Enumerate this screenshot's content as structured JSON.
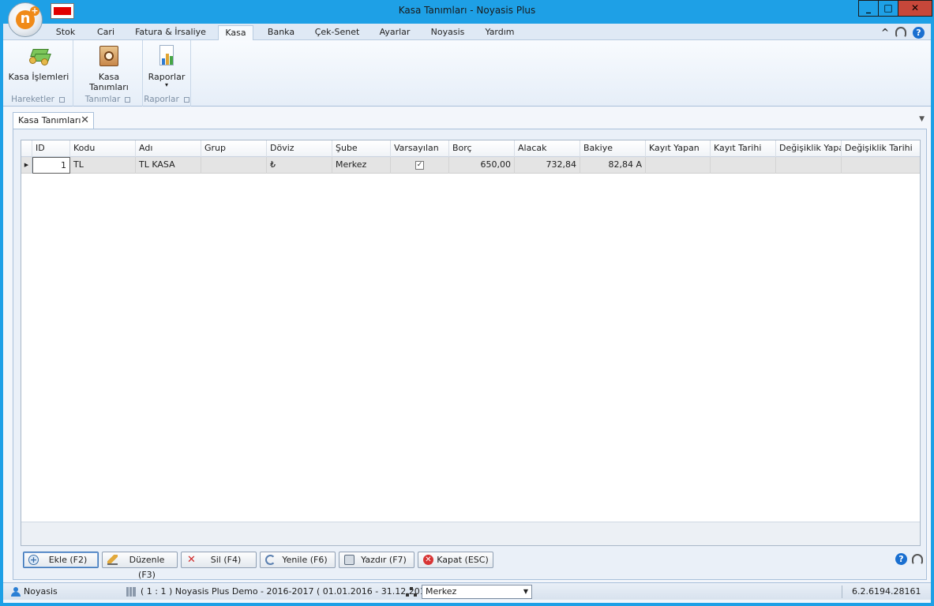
{
  "window": {
    "title": "Kasa Tanımları - Noyasis Plus"
  },
  "menu_tabs": [
    {
      "label": "Stok",
      "active": false
    },
    {
      "label": "Cari",
      "active": false
    },
    {
      "label": "Fatura & İrsaliye",
      "active": false
    },
    {
      "label": "Kasa",
      "active": true
    },
    {
      "label": "Banka",
      "active": false
    },
    {
      "label": "Çek-Senet",
      "active": false
    },
    {
      "label": "Ayarlar",
      "active": false
    },
    {
      "label": "Noyasis",
      "active": false
    },
    {
      "label": "Yardım",
      "active": false
    }
  ],
  "ribbon": {
    "buttons": [
      {
        "label": "Kasa İşlemleri",
        "icon": "money-icon"
      },
      {
        "label": "Kasa Tanımları",
        "icon": "safe-icon"
      },
      {
        "label": "Raporlar",
        "icon": "report-icon",
        "dropdown": "▾"
      }
    ],
    "groups": [
      "Hareketler",
      "Tanımlar",
      "Raporlar"
    ]
  },
  "document_tab": {
    "label": "Kasa Tanımları",
    "close": "✕"
  },
  "grid": {
    "columns": [
      "ID",
      "Kodu",
      "Adı",
      "Grup",
      "Döviz",
      "Şube",
      "Varsayılan",
      "Borç",
      "Alacak",
      "Bakiye",
      "Kayıt Yapan",
      "Kayıt Tarihi",
      "Değişiklik Yapan",
      "Değişiklik Tarihi"
    ],
    "rows": [
      {
        "id": "1",
        "kodu": "TL",
        "adi": "TL KASA",
        "grup": "",
        "doviz": "₺",
        "sube": "Merkez",
        "varsayilan": true,
        "borc": "650,00",
        "alacak": "732,84",
        "bakiye": "82,84 A",
        "kayit_yapan": "",
        "kayit_tarihi": "",
        "degisiklik_yapan": "",
        "degisiklik_tarihi": ""
      }
    ]
  },
  "actions": [
    {
      "label": "Ekle (F2)",
      "icon": "plus-icon"
    },
    {
      "label": "Düzenle (F3)",
      "icon": "pencil-icon"
    },
    {
      "label": "Sil (F4)",
      "icon": "delete-icon"
    },
    {
      "label": "Yenile (F6)",
      "icon": "refresh-icon"
    },
    {
      "label": "Yazdır (F7)",
      "icon": "print-icon"
    },
    {
      "label": "Kapat (ESC)",
      "icon": "close-circle-icon"
    }
  ],
  "status": {
    "user": "Noyasis",
    "database": "( 1 : 1 )  Noyasis Plus Demo - 2016-2017  ( 01.01.2016 - 31.12.2017 )",
    "branch": "Merkez",
    "version": "6.2.6194.28161"
  },
  "colors": {
    "titlebar": "#1ea0e6",
    "selected_row": "#e4e4e4",
    "accent": "#f08a18"
  }
}
